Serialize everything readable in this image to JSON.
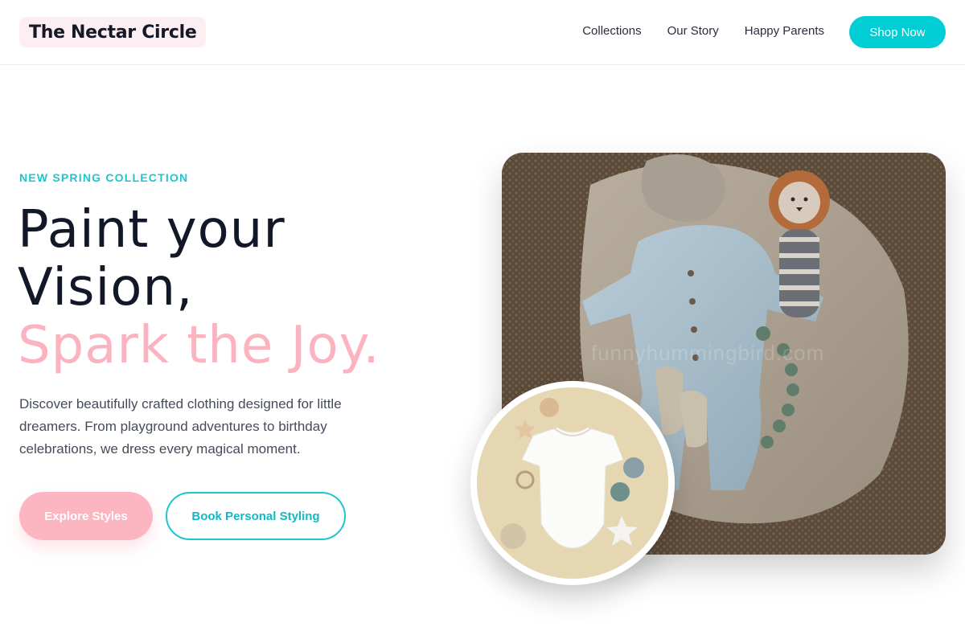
{
  "header": {
    "logo": "The Nectar Circle",
    "nav": [
      "Collections",
      "Our Story",
      "Happy Parents"
    ],
    "cta": "Shop Now"
  },
  "hero": {
    "eyebrow": "NEW SPRING COLLECTION",
    "headline_line1": "Paint your",
    "headline_line2": "Vision,",
    "headline_accent": "Spark the Joy.",
    "description": "Discover beautifully crafted clothing designed for little dreamers. From playground adventures to birthday celebrations, we dress every magical moment.",
    "primary_button": "Explore Styles",
    "secondary_button": "Book Personal Styling",
    "watermark": "funnyhummingbird.com"
  },
  "colors": {
    "accent_teal": "#00cdd4",
    "accent_pink": "#fcb6c1",
    "logo_bg": "#fdeef1",
    "text_dark": "#121828"
  },
  "images": {
    "main": "flat-lay-baby-romper-lion-plush-on-woven-rug",
    "inset": "white-baby-bodysuit-on-beige-with-star-toys"
  }
}
